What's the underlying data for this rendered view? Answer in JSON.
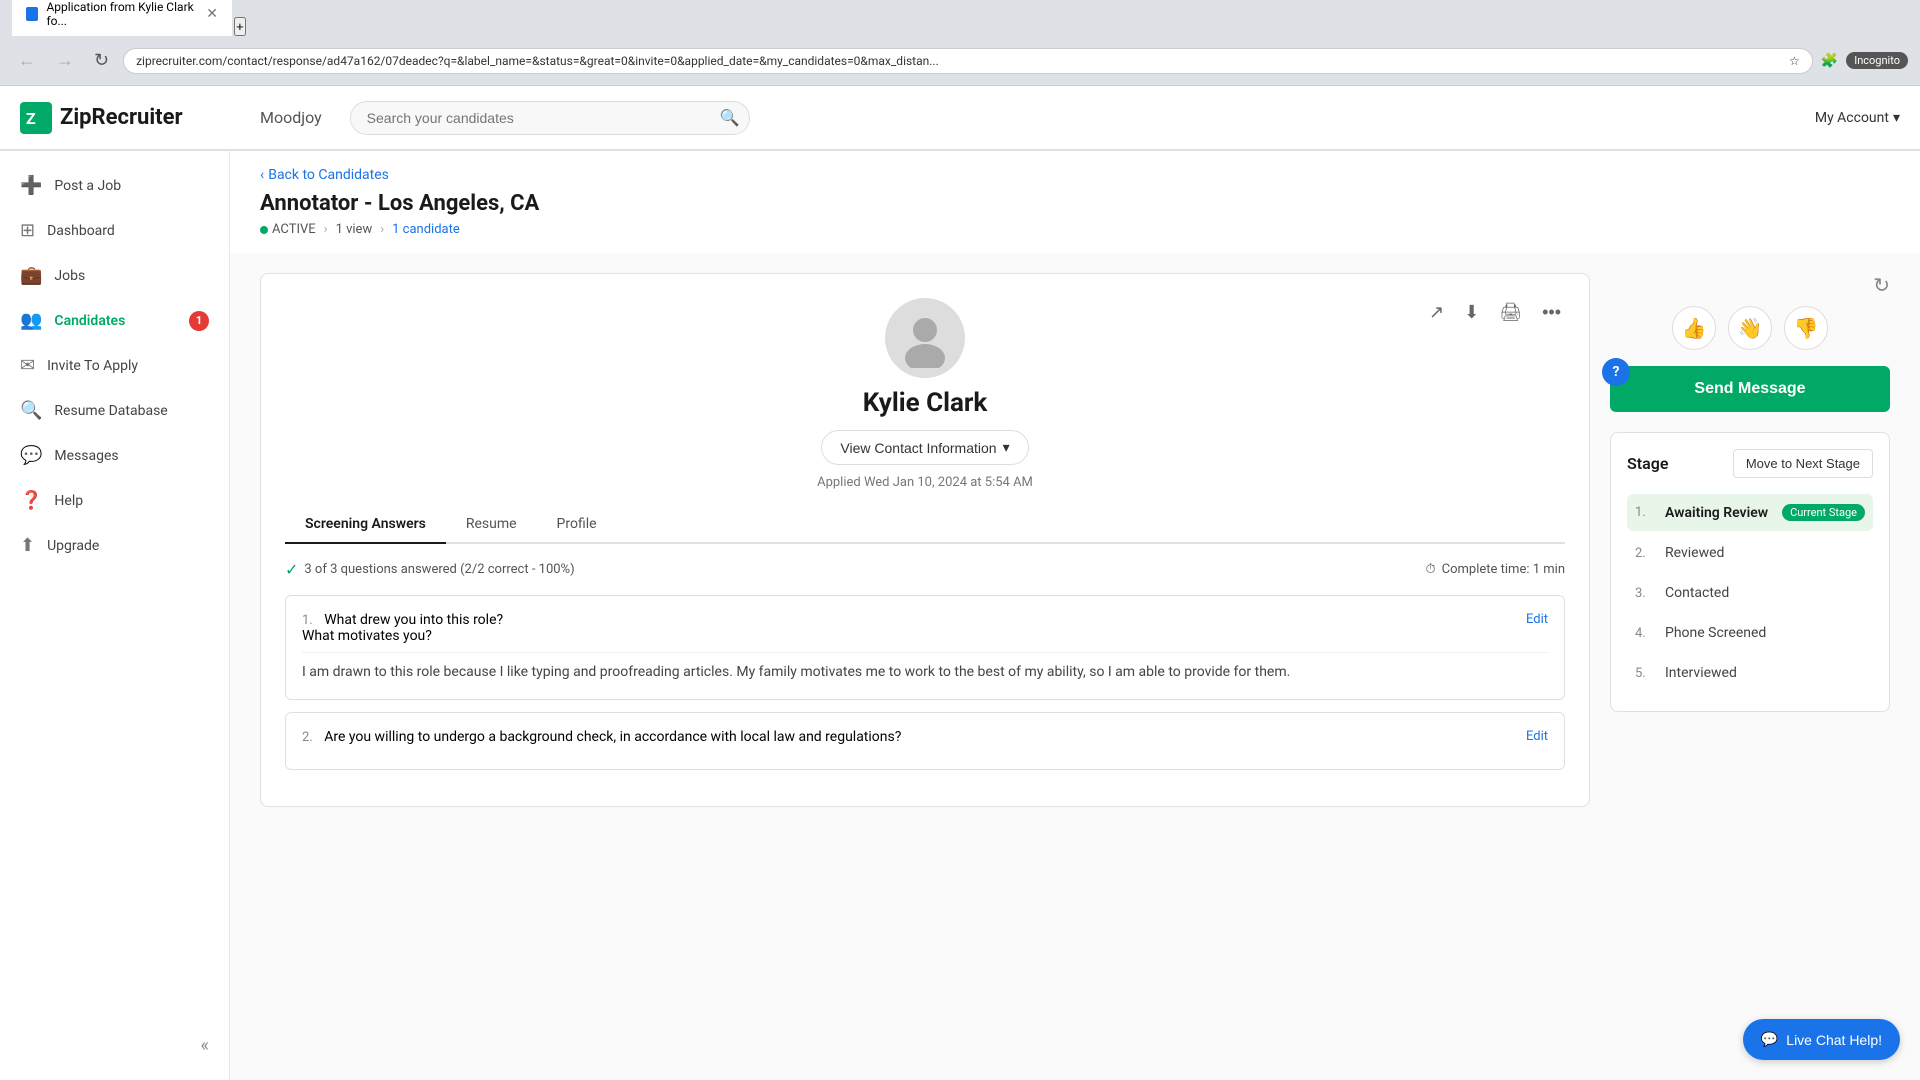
{
  "browser": {
    "url": "ziprecruiter.com/contact/response/ad47a162/07deadec?q=&label_name=&status=&great=0&invite=0&applied_date=&my_candidates=0&max_distan...",
    "tab_title": "Application from Kylie Clark fo...",
    "incognito_label": "Incognito"
  },
  "header": {
    "company_name": "Moodjoy",
    "search_placeholder": "Search your candidates",
    "my_account_label": "My Account"
  },
  "sidebar": {
    "items": [
      {
        "id": "post-job",
        "label": "Post a Job",
        "icon": "➕"
      },
      {
        "id": "dashboard",
        "label": "Dashboard",
        "icon": "⊞"
      },
      {
        "id": "jobs",
        "label": "Jobs",
        "icon": "💼"
      },
      {
        "id": "candidates",
        "label": "Candidates",
        "icon": "👥",
        "badge": "1",
        "active": true
      },
      {
        "id": "invite-to-apply",
        "label": "Invite To Apply",
        "icon": "✉"
      },
      {
        "id": "resume-database",
        "label": "Resume Database",
        "icon": "🔍"
      },
      {
        "id": "messages",
        "label": "Messages",
        "icon": "💬"
      },
      {
        "id": "help",
        "label": "Help",
        "icon": "❓"
      },
      {
        "id": "upgrade",
        "label": "Upgrade",
        "icon": "⬆"
      }
    ]
  },
  "breadcrumb": {
    "back_label": "Back to Candidates"
  },
  "job": {
    "title": "Annotator - Los Angeles, CA",
    "status": "ACTIVE",
    "views": "1 view",
    "candidates": "1 candidate"
  },
  "candidate": {
    "name": "Kylie Clark",
    "applied_text": "Applied Wed Jan 10, 2024 at 5:54 AM",
    "contact_info_label": "View Contact Information",
    "tabs": [
      {
        "id": "screening",
        "label": "Screening Answers",
        "active": true
      },
      {
        "id": "resume",
        "label": "Resume"
      },
      {
        "id": "profile",
        "label": "Profile"
      }
    ],
    "qa_summary": "3 of 3 questions answered (2/2 correct - 100%)",
    "complete_time": "Complete time: 1 min",
    "questions": [
      {
        "number": "1.",
        "question": "What drew you into this role?\nWhat motivates you?",
        "answer": "I am drawn to this role because I like typing and proofreading articles. My family motivates me to work to the best of my ability, so I am able to provide for them."
      },
      {
        "number": "2.",
        "question": "Are you willing to undergo a background check, in accordance with local law and regulations?"
      }
    ]
  },
  "right_panel": {
    "send_message_label": "Send Message",
    "help_icon": "?",
    "refresh_icon": "↻"
  },
  "stage_panel": {
    "title": "Stage",
    "move_stage_label": "Move to Next Stage",
    "stages": [
      {
        "number": "1.",
        "name": "Awaiting Review",
        "current": true,
        "badge": "Current Stage"
      },
      {
        "number": "2.",
        "name": "Reviewed"
      },
      {
        "number": "3.",
        "name": "Contacted"
      },
      {
        "number": "4.",
        "name": "Phone Screened"
      },
      {
        "number": "5.",
        "name": "Interviewed"
      }
    ]
  },
  "live_chat": {
    "label": "Live Chat Help!"
  }
}
